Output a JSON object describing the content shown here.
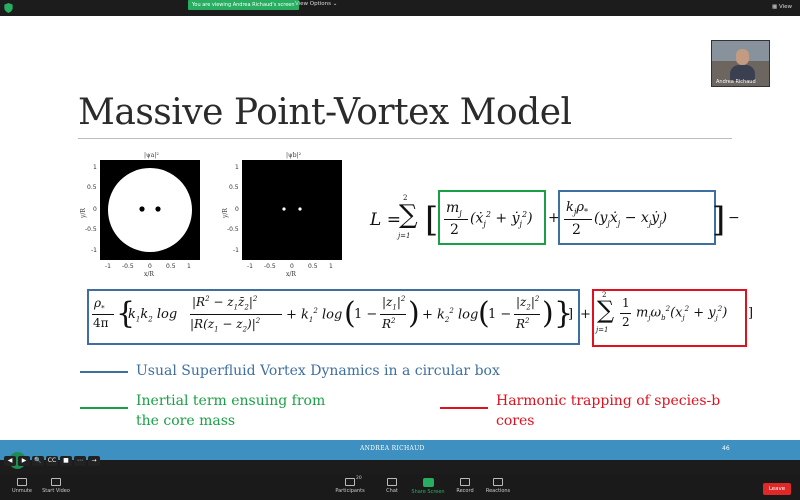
{
  "zoom": {
    "viewing_label": "You are viewing Andrea Richaud's screen",
    "view_options": "View Options",
    "top_view": "View",
    "participant_name": "Andrea Richaud"
  },
  "slide": {
    "title": "Massive Point-Vortex Model",
    "plot_left_title": "|ψa|²",
    "plot_right_title": "|ψb|²",
    "plot_ylabel": "y/R",
    "plot_xlabel": "x/R",
    "xticks": [
      "-1",
      "-0.5",
      "0",
      "0.5",
      "1"
    ],
    "yticks": [
      "1",
      "0.5",
      "0",
      "-0.5",
      "-1"
    ],
    "legend": {
      "blue": "Usual Superfluid Vortex Dynamics in a circular box",
      "green_line1": "Inertial term ensuing from",
      "green_line2": "the core mass",
      "red_line1": "Harmonic trapping of species-b",
      "red_line2": "cores"
    },
    "colors": {
      "blue": "#3e6fa0",
      "green": "#19a046",
      "red": "#e0101e"
    },
    "footer_name": "ANDREA RICHAUD",
    "page_number": "46"
  },
  "controls": {
    "unmute": "Unmute",
    "start_video": "Start Video",
    "participants": "Participants",
    "participants_count": "20",
    "chat": "Chat",
    "share_screen": "Share Screen",
    "record": "Record",
    "reactions": "Reactions",
    "leave": "Leave"
  }
}
